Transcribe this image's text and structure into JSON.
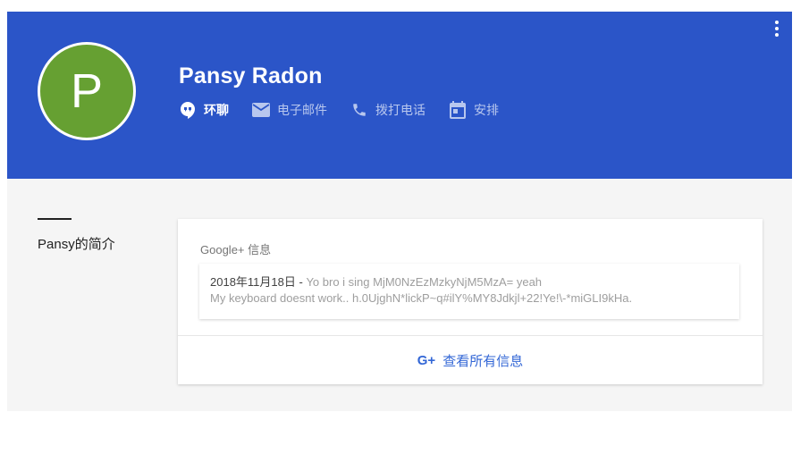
{
  "profile": {
    "initial": "P",
    "name": "Pansy Radon"
  },
  "actions": [
    {
      "label": "环聊",
      "icon": "hangouts-icon"
    },
    {
      "label": "电子邮件",
      "icon": "email-icon"
    },
    {
      "label": "拨打电话",
      "icon": "phone-icon"
    },
    {
      "label": "安排",
      "icon": "calendar-icon"
    }
  ],
  "about": {
    "label": "Pansy的简介"
  },
  "google_plus": {
    "title": "Google+ 信息",
    "post_date": "2018年11月18日",
    "post_separator": " - ",
    "post_line1": "Yo bro i sing MjM0NzEzMzkyNjM5MzA= yeah",
    "post_line2": "My keyboard doesnt work.. h.0UjghN*lickP~q#ilY%MY8Jdkjl+22!Ye!\\-*miGLI9kHa.",
    "view_all_icon": "G+",
    "view_all_label": "查看所有信息"
  },
  "colors": {
    "header": "#2b55c8",
    "avatar": "#66a032",
    "link": "#3367d6"
  }
}
